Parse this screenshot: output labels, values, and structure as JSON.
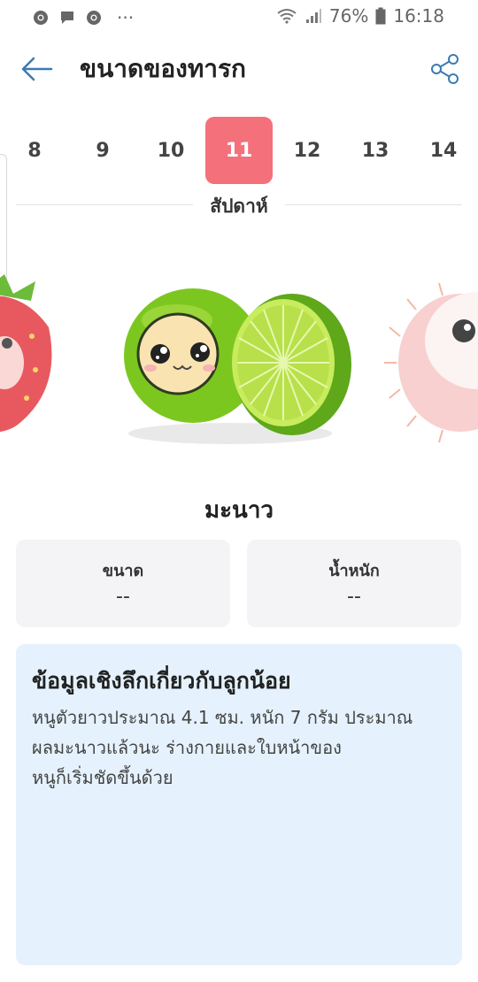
{
  "status_bar": {
    "battery": "76%",
    "time": "16:18",
    "overflow": "···",
    "icons": [
      "chrome-icon",
      "message-icon",
      "chrome-icon",
      "wifi-icon",
      "signal-icon",
      "battery-icon"
    ]
  },
  "header": {
    "title": "ขนาดของทารก",
    "icons": [
      "back-arrow-icon",
      "share-icon"
    ]
  },
  "weeks": {
    "items": [
      "8",
      "9",
      "10",
      "11",
      "12",
      "13",
      "14"
    ],
    "selected": "11",
    "label": "สัปดาห์"
  },
  "fruit": {
    "name": "มะนาว",
    "colors": {
      "lime": "#7cc71f",
      "lime_light": "#c8ec5e",
      "face": "#f9e3b1"
    }
  },
  "stats": {
    "size_label": "ขนาด",
    "size_value": "--",
    "weight_label": "น้ำหนัก",
    "weight_value": "--"
  },
  "info": {
    "title": "ข้อมูลเชิงลึกเกี่ยวกับลูกน้อย",
    "body": "หนูตัวยาวประมาณ 4.1 ซม. หนัก 7 กรัม ประมาณ\nผลมะนาวแล้วนะ ร่างกายและใบหน้าของ\nหนูก็เริ่มชัดขึ้นด้วย"
  },
  "colors": {
    "accent": "#f4707a",
    "card_bg": "#f4f4f6",
    "info_bg": "#e5f2fd"
  }
}
